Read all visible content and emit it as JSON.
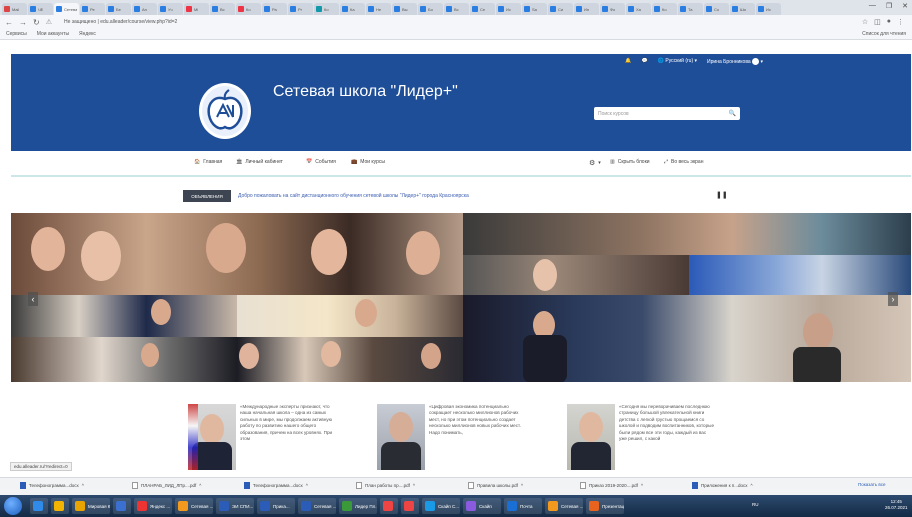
{
  "browser": {
    "tabs": [
      {
        "label": "Mail",
        "color": "#d44"
      },
      {
        "label": "ЧЕ",
        "color": "#2a7de1"
      },
      {
        "label": "Сетевая",
        "color": "#2a7de1"
      },
      {
        "label": "Ре",
        "color": "#2a7de1"
      },
      {
        "label": "Бе",
        "color": "#2a7de1"
      },
      {
        "label": "Ан",
        "color": "#2a7de1"
      },
      {
        "label": "Уч",
        "color": "#2a7de1"
      },
      {
        "label": "Mi",
        "color": "#e34"
      },
      {
        "label": "Вс",
        "color": "#2a7de1"
      },
      {
        "label": "Ко",
        "color": "#e34"
      },
      {
        "label": "Ра",
        "color": "#2a7de1"
      },
      {
        "label": "Pr",
        "color": "#2a7de1"
      },
      {
        "label": "Ко",
        "color": "#19a"
      },
      {
        "label": "Ка",
        "color": "#2a7de1"
      },
      {
        "label": "Не",
        "color": "#2a7de1"
      },
      {
        "label": "Вы",
        "color": "#2a7de1"
      },
      {
        "label": "Бо",
        "color": "#2a7de1"
      },
      {
        "label": "Вс",
        "color": "#2a7de1"
      },
      {
        "label": "Се",
        "color": "#2a7de1"
      },
      {
        "label": "Ис",
        "color": "#2a7de1"
      },
      {
        "label": "Sa",
        "color": "#2a7de1"
      },
      {
        "label": "Си",
        "color": "#2a7de1"
      },
      {
        "label": "Ин",
        "color": "#2a7de1"
      },
      {
        "label": "Фо",
        "color": "#2a7de1"
      },
      {
        "label": "Ха",
        "color": "#2a7de1"
      },
      {
        "label": "Ко",
        "color": "#2a7de1"
      },
      {
        "label": "Та",
        "color": "#2a7de1"
      },
      {
        "label": "Со",
        "color": "#2a7de1"
      },
      {
        "label": "Ши",
        "color": "#2a7de1"
      },
      {
        "label": "Ис",
        "color": "#2a7de1"
      }
    ],
    "active_tab_index": 2,
    "url": "Не защищено | edu.alleader/course/view.php?id=2",
    "bookmarks": [
      "Сервисы",
      "Мои аккаунты",
      "Яндекс"
    ],
    "bookmarks_right": "Список для чтения",
    "window_controls": [
      "—",
      "❐",
      "✕"
    ]
  },
  "site": {
    "title": "Сетевая школа \"Лидер+\"",
    "search_placeholder": "Поиск курсов",
    "language": "Русский (ru)",
    "user_name": "Ирина Бронникова",
    "nav": {
      "home": "Главная",
      "cabinet": "Личный кабинет",
      "events": "События",
      "my_courses": "Мои курсы",
      "hide_blocks": "Скрыть блоки",
      "fullscreen": "Во весь экран"
    },
    "ticker": {
      "badge": "ОБЪЯВЛЕНИЯ",
      "text": "Добро пожаловать на сайт дистанционного обучения сетевой школы \"Лидер+\" города Красноярска"
    },
    "quotes": [
      {
        "text": "«Международные эксперты признают, что наша начальная школа – одна из самых сильных в мире, мы продолжаем активную работу по развитию нашего общего образования, причем на всех уровнях. При этом"
      },
      {
        "text": "«Цифровая экономика потенциально сокращает несколько миллионов рабочих мест, но при этом потенциально создает несколько миллионов новых рабочих мест. Надо понимать,"
      },
      {
        "text": "«Сегодня мы переворачиваем последнюю страницу большой увлекательной книги детства с легкой грустью прощаемся со школой и подводим воспитанников, которые были рядом все эти годы, каждый из вас уже решил, с какой"
      }
    ],
    "status_url": "edu.alleader.ru/?redirect=0"
  },
  "downloads": [
    {
      "name": "Телефонограмма...docx",
      "type": "doc"
    },
    {
      "name": "ПЛАНРАБ_ЛИД_ЛПр....pdf",
      "type": "pdf"
    },
    {
      "name": "Телефонограмма...docx",
      "type": "doc"
    },
    {
      "name": "План работы пр....pdf",
      "type": "pdf"
    },
    {
      "name": "Правила школы.pdf",
      "type": "pdf"
    },
    {
      "name": "Приказ 2019-2020....pdf",
      "type": "pdf"
    },
    {
      "name": "Приложения к п...docx",
      "type": "doc"
    }
  ],
  "downloads_show_all": "Показать все",
  "taskbar": {
    "items": [
      {
        "label": "",
        "color": "#2f8ae8"
      },
      {
        "label": "",
        "color": "#f2b400"
      },
      {
        "label": "Мировая К...",
        "color": "#e8a400"
      },
      {
        "label": "",
        "color": "#3b6fd0"
      },
      {
        "label": "Яндекс ...",
        "color": "#e33"
      },
      {
        "label": "Сетевая ...",
        "color": "#f39a1e"
      },
      {
        "label": "ЭИ СПИ...",
        "color": "#2b5cb8"
      },
      {
        "label": "Прика...",
        "color": "#2b5cb8"
      },
      {
        "label": "Сетевая ...",
        "color": "#2b5cb8"
      },
      {
        "label": "Лидер Пл...",
        "color": "#3a9a3a"
      },
      {
        "label": "",
        "color": "#e44"
      },
      {
        "label": "",
        "color": "#e44"
      },
      {
        "label": "Скайп С...",
        "color": "#1a9ae6"
      },
      {
        "label": "Скайп",
        "color": "#8a5adf"
      },
      {
        "label": "Почта",
        "color": "#1a6fd6"
      },
      {
        "label": "Сетевая ...",
        "color": "#f39a1e"
      },
      {
        "label": "Презентация...",
        "color": "#e8641e"
      }
    ],
    "tray": "RU",
    "time": "12:45",
    "date": "26.07.2021"
  }
}
